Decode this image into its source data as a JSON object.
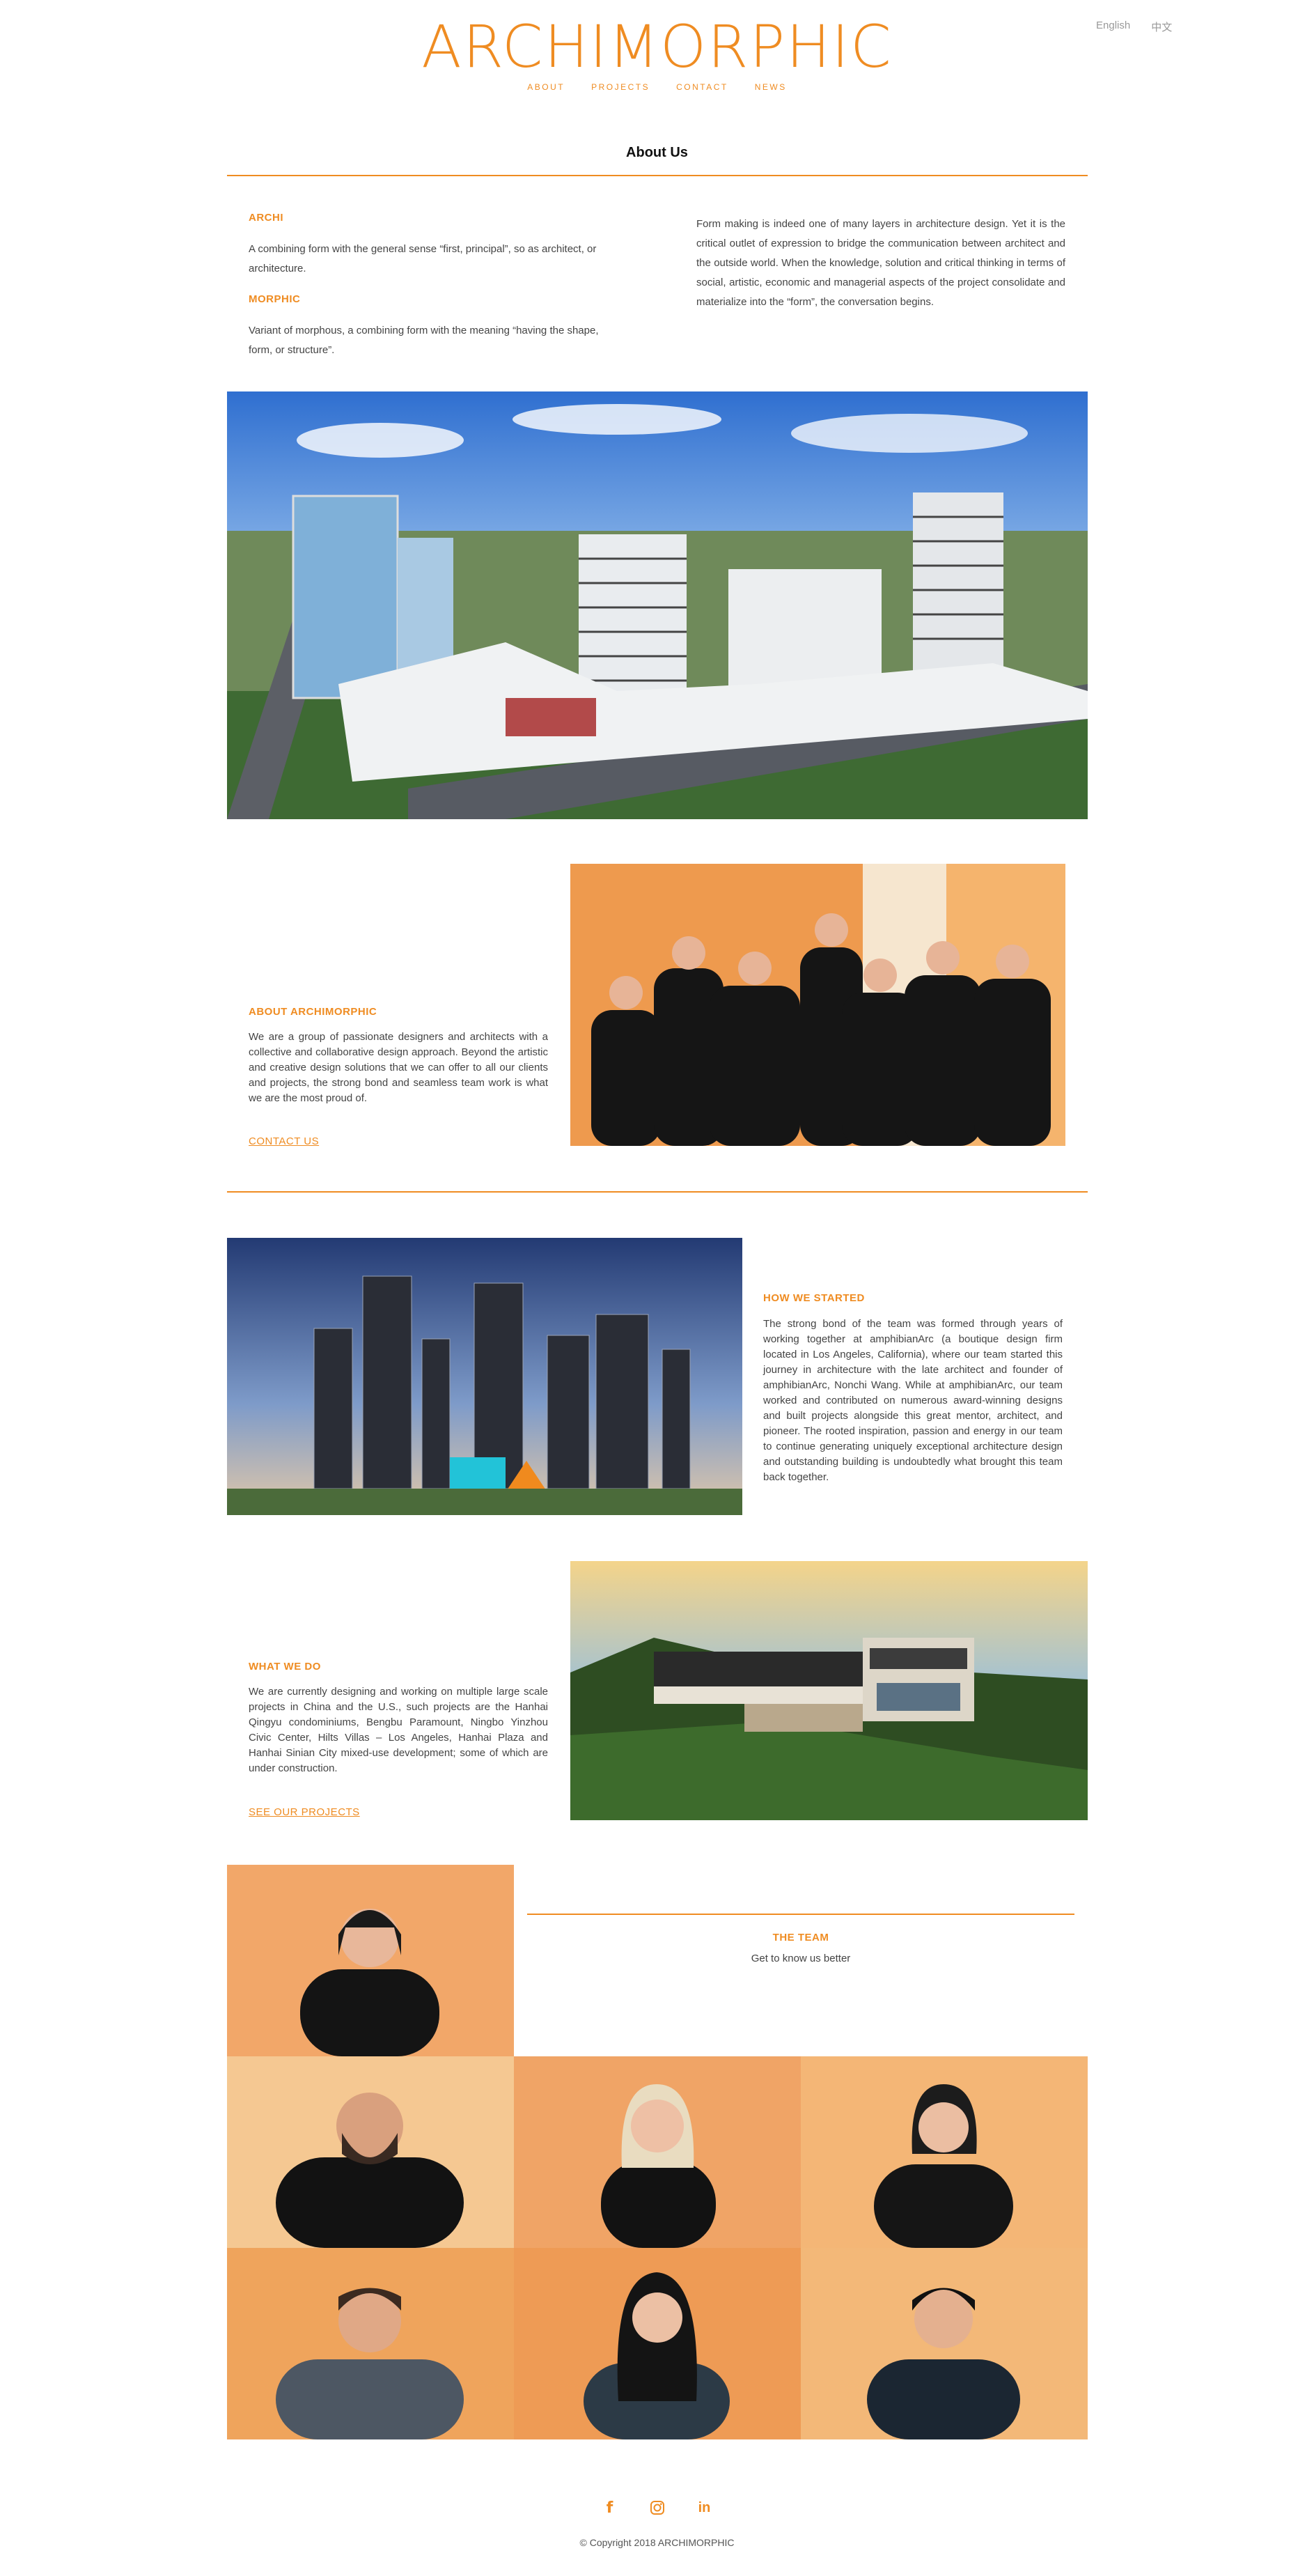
{
  "header": {
    "logo": "ARCHIMORPHIC",
    "nav": [
      "ABOUT",
      "PROJECTS",
      "CONTACT",
      "NEWS"
    ],
    "languages": [
      "English",
      "中文"
    ]
  },
  "page_title": "About Us",
  "intro": {
    "archi_heading": "ARCHI",
    "archi_text": "A combining form with the general sense “first, principal”, so as architect, or architecture.",
    "morphic_heading": "MORPHIC",
    "morphic_text": "Variant of morphous, a combining form with the meaning “having the shape, form, or structure”.",
    "right_text": "Form making is indeed one of many layers in architecture design. Yet it is the critical outlet of expression to bridge the communication between architect and the outside world. When the knowledge, solution and critical thinking in terms of social, artistic, economic and managerial aspects of the project consolidate and materialize into the “form”, the conversation begins."
  },
  "about": {
    "heading": "ABOUT ARCHIMORPHIC",
    "text": "We are a group of passionate designers and architects with a collective and collaborative design approach. Beyond the artistic and creative design solutions that we can offer to all our clients and projects, the strong bond and seamless team work is what we are the most proud of.",
    "link": "CONTACT US"
  },
  "started": {
    "heading": "HOW WE STARTED",
    "text": "The strong bond of the team was formed through years of working together at amphibianArc (a boutique design firm located in Los Angeles, California), where our team started this journey in architecture with the late architect and founder of amphibianArc, Nonchi Wang. While at amphibianArc, our team worked and contributed on numerous award-winning designs and built projects alongside this great mentor, architect, and pioneer. The rooted inspiration, passion and energy in our team to continue generating uniquely exceptional architecture design and outstanding building is undoubtedly what brought this team back together."
  },
  "whatwedo": {
    "heading": "WHAT WE DO",
    "text": "We are currently designing and working on multiple large scale projects in China and the U.S., such projects are the Hanhai Qingyu condominiums, Bengbu Paramount, Ningbo Yinzhou Civic Center, Hilts Villas – Los Angeles, Hanhai Plaza and Hanhai Sinian City mixed-use development; some of which are under construction.",
    "link": "SEE OUR PROJECTS"
  },
  "team": {
    "heading": "THE TEAM",
    "subheading": "Get to know us better"
  },
  "footer": {
    "icons": [
      "facebook-icon",
      "instagram-icon",
      "linkedin-icon"
    ],
    "copyright": "© Copyright 2018 ARCHIMORPHIC"
  },
  "colors": {
    "accent": "#ef8c22",
    "portrait_bg": "#f2b27c"
  }
}
